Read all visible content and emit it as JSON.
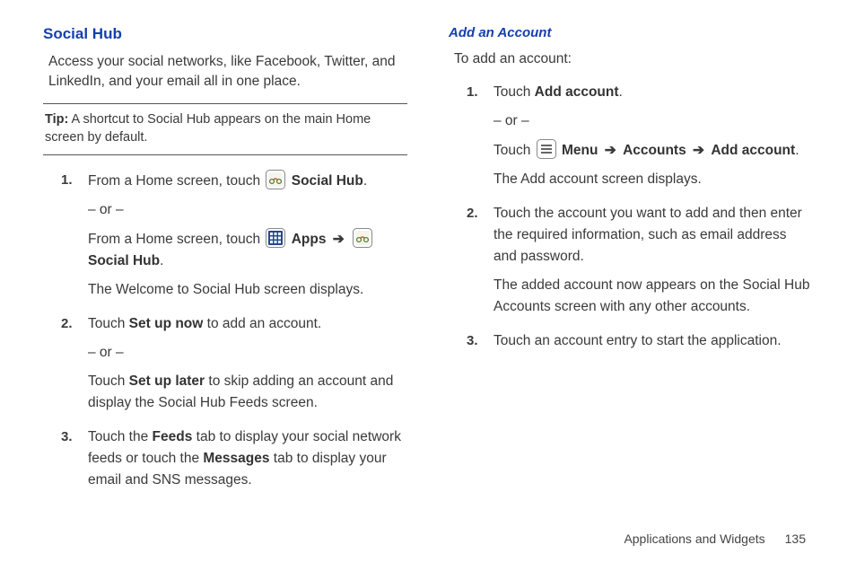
{
  "left": {
    "heading": "Social Hub",
    "intro": "Access your social networks, like Facebook, Twitter, and LinkedIn, and your email all in one place.",
    "tip_label": "Tip:",
    "tip_text": " A shortcut to Social Hub appears on the main Home screen by default.",
    "step1_a": "From a Home screen, touch ",
    "step1_social_hub": "Social Hub",
    "step1_or": "– or –",
    "step1_b": "From a Home screen, touch ",
    "step1_apps": "Apps",
    "step1_c": "The Welcome to Social Hub screen displays.",
    "step2_a1": "Touch ",
    "step2_setup_now": "Set up now",
    "step2_a2": " to add an account.",
    "step2_or": "– or –",
    "step2_b1": "Touch ",
    "step2_setup_later": "Set up later",
    "step2_b2": " to skip adding an account and display the Social Hub Feeds screen.",
    "step3_a": "Touch the ",
    "step3_feeds": "Feeds",
    "step3_b": " tab to display your social network feeds or touch the ",
    "step3_messages": "Messages",
    "step3_c": " tab to display your email and SNS messages."
  },
  "right": {
    "heading": "Add an Account",
    "intro": "To add an account:",
    "step1_a": "Touch ",
    "step1_add_account": "Add account",
    "step1_or": "– or –",
    "step1_b": "Touch ",
    "step1_menu": "Menu",
    "step1_accounts": "Accounts",
    "step1_add_account2": "Add account",
    "step1_c": "The Add account screen displays.",
    "step2_a": "Touch the account you want to add and then enter the required information, such as email address and password.",
    "step2_b": "The added account now appears on the Social Hub Accounts screen with any other accounts.",
    "step3": "Touch an account entry to start the application."
  },
  "footer": {
    "section": "Applications and Widgets",
    "page": "135"
  },
  "arrow": "➔",
  "period": "."
}
